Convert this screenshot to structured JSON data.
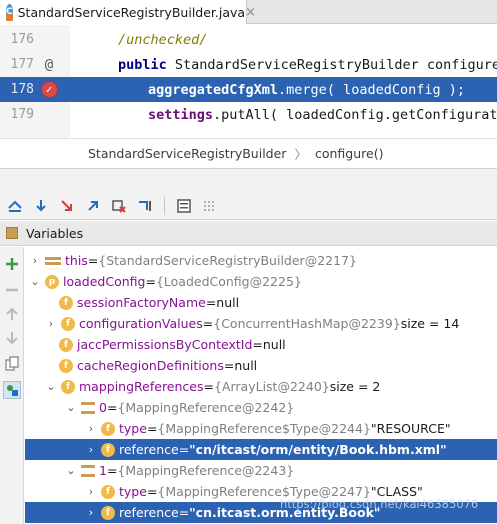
{
  "tab": {
    "filename": "StandardServiceRegistryBuilder.java",
    "close": "×"
  },
  "code": {
    "lines": [
      {
        "num": "176",
        "text": "/unchecked/"
      },
      {
        "num": "177",
        "kw": "public",
        "rest": " StandardServiceRegistryBuilder configure"
      },
      {
        "num": "178",
        "fn": "aggregatedCfgXml",
        "rest": ".merge( loadedConfig );"
      },
      {
        "num": "179",
        "fn": "settings",
        "rest": ".putAll( loadedConfig.getConfigurat"
      }
    ],
    "at_marker": "@"
  },
  "breadcrumb": {
    "items": [
      "StandardServiceRegistryBuilder",
      "configure()"
    ]
  },
  "variables_panel": {
    "title": "Variables"
  },
  "tree": [
    {
      "name": "this",
      "eq": " = ",
      "val": "{StandardServiceRegistryBuilder@2217}"
    },
    {
      "name": "loadedConfig",
      "eq": " = ",
      "val": "{LoadedConfig@2225}"
    },
    {
      "name": "sessionFactoryName",
      "eq": " = ",
      "plain": "null"
    },
    {
      "name": "configurationValues",
      "eq": " = ",
      "val": "{ConcurrentHashMap@2239}",
      "plain": "  size = 14"
    },
    {
      "name": "jaccPermissionsByContextId",
      "eq": " = ",
      "plain": "null"
    },
    {
      "name": "cacheRegionDefinitions",
      "eq": " = ",
      "plain": "null"
    },
    {
      "name": "mappingReferences",
      "eq": " = ",
      "val": "{ArrayList@2240}",
      "plain": "  size = 2"
    },
    {
      "name": "0",
      "eq": " = ",
      "val": "{MappingReference@2242}"
    },
    {
      "name": "type",
      "eq": " = ",
      "val": "{MappingReference$Type@2244}",
      "plain": " \"RESOURCE\""
    },
    {
      "name": "reference",
      "eq": " = ",
      "str": "\"cn/itcast/orm/entity/Book.hbm.xml\""
    },
    {
      "name": "1",
      "eq": " = ",
      "val": "{MappingReference@2243}"
    },
    {
      "name": "type",
      "eq": " = ",
      "val": "{MappingReference$Type@2247}",
      "plain": " \"CLASS\""
    },
    {
      "name": "reference",
      "eq": " = ",
      "str": "\"cn.itcast.orm.entity.Book\""
    }
  ],
  "watermark": "https://blog.csdn.net/kai46385076",
  "colors": {
    "selection": "#2b62b2",
    "field_icon": "#f1b94a",
    "var_name": "#871094"
  }
}
